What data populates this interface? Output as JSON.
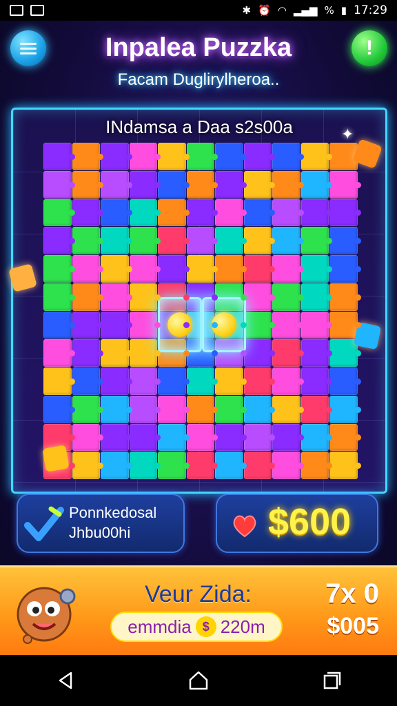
{
  "status_bar": {
    "time": "17:29",
    "battery": "%",
    "left_icons": [
      "gallery-icon",
      "image-icon"
    ],
    "right_icons": [
      "nfc-icon",
      "alarm-icon",
      "wifi-icon",
      "signal-icon",
      "battery-icon"
    ]
  },
  "header": {
    "title": "Inpalea Puzzka",
    "subtitle": "Facam Duglirylheroa..",
    "menu_icon": "menu-icon",
    "alert_icon": "alert-icon",
    "alert_symbol": "!"
  },
  "board": {
    "heading": "INdamsa a Daa s2s00a",
    "grid_cols": 11,
    "grid_rows": 12,
    "piece_colors": [
      "#ff4de0",
      "#ff8a1a",
      "#2de24d",
      "#1fb6ff",
      "#8a2bff",
      "#ffc21a",
      "#2a5dff",
      "#00d9c0",
      "#ff3b6b",
      "#b84dff"
    ]
  },
  "status_cards": {
    "completed_label": "Ponnkedosal",
    "completed_sub": "Jhbu00hi",
    "score": "$600"
  },
  "banner": {
    "title": "Veur Zida:",
    "promo_left": "emmdia",
    "promo_icon_text": "$",
    "promo_right": "220m",
    "multiplier": "7x 0",
    "price": "$005"
  },
  "nav": {
    "back_icon": "back-icon",
    "home_icon": "home-icon",
    "recents_icon": "recents-icon"
  }
}
